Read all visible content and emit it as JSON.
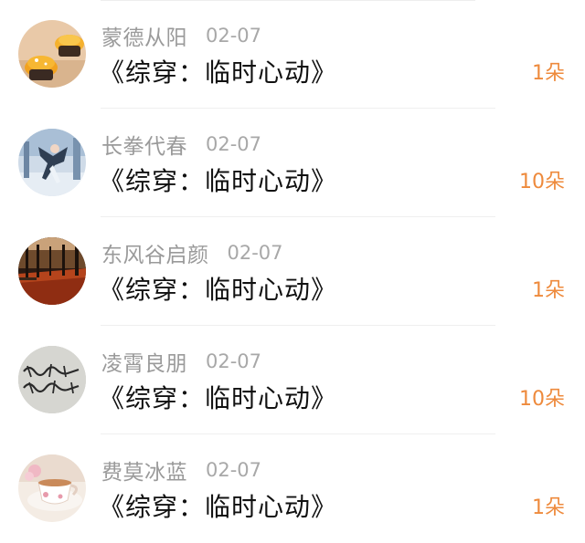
{
  "colors": {
    "username": "#9a9a9a",
    "date": "#a8a8a8",
    "title": "#111111",
    "amount": "#ee8a3c",
    "divider": "#efefef"
  },
  "gifts": [
    {
      "user": "蒙德从阳",
      "date": "02-07",
      "book": "《综穿：临时心动》",
      "amount": "1朵",
      "avatar_icon": "cupcake-avatar"
    },
    {
      "user": "长拳代春",
      "date": "02-07",
      "book": "《综穿：临时心动》",
      "amount": "10朵",
      "avatar_icon": "figure-skater-avatar"
    },
    {
      "user": "东风谷启颜",
      "date": "02-07",
      "book": "《综穿：临时心动》",
      "amount": "1朵",
      "avatar_icon": "autumn-path-avatar"
    },
    {
      "user": "凌霄良朋",
      "date": "02-07",
      "book": "《综穿：临时心动》",
      "amount": "10朵",
      "avatar_icon": "handwriting-avatar"
    },
    {
      "user": "费莫冰蓝",
      "date": "02-07",
      "book": "《综穿：临时心动》",
      "amount": "1朵",
      "avatar_icon": "teacup-avatar"
    }
  ]
}
